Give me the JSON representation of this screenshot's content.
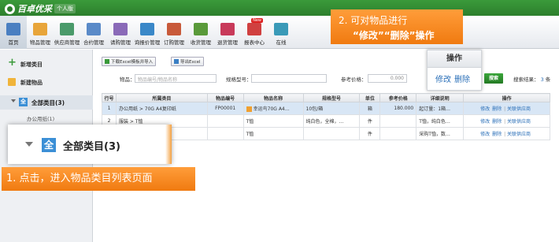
{
  "header": {
    "app_name": "百卓优采",
    "edition": "个人版"
  },
  "toolbar": {
    "items": [
      {
        "label": "首页",
        "icon": "home-icon",
        "color": "#4a7fc1"
      },
      {
        "label": "物品管理",
        "icon": "box-icon",
        "color": "#e8a53a"
      },
      {
        "label": "供应商管理",
        "icon": "supplier-icon",
        "color": "#4a9a6a"
      },
      {
        "label": "合约管理",
        "icon": "contract-icon",
        "color": "#5a8ac8"
      },
      {
        "label": "请购管理",
        "icon": "request-icon",
        "color": "#8a6ab8"
      },
      {
        "label": "询报价管理",
        "icon": "quote-icon",
        "color": "#3a88c8"
      },
      {
        "label": "订购管理",
        "icon": "order-icon",
        "color": "#c85a3a"
      },
      {
        "label": "收货管理",
        "icon": "receive-icon",
        "color": "#5a9a3a"
      },
      {
        "label": "退货管理",
        "icon": "return-icon",
        "color": "#c83a5a"
      },
      {
        "label": "报表中心",
        "icon": "report-icon",
        "color": "#d04040",
        "badge": "New"
      },
      {
        "label": "在线",
        "icon": "online-icon",
        "color": "#3a9ab8"
      }
    ]
  },
  "sidebar": {
    "add_category": "新增类目",
    "add_item": "新建物品",
    "tree_root": "全部类目(3)",
    "tree_child": "办公用纸(1)"
  },
  "content": {
    "import_btn": "下载Excel模板并导入",
    "export_btn": "导出Excel",
    "item_label": "物品：",
    "item_placeholder": "物品编号/物品名称",
    "spec_label": "规格型号：",
    "price_label": "参考价格：",
    "price_from": "0.000",
    "search_btn": "搜索",
    "result_label": "搜索结果：",
    "result_count": "3",
    "result_unit": "条"
  },
  "table": {
    "headers": [
      "行号",
      "所属类目",
      "物品编号",
      "物品名称",
      "规格型号",
      "单位",
      "参考价格",
      "详细说明",
      "操作"
    ],
    "rows": [
      {
        "no": "1",
        "category": "办公用纸 > 70G A4复印纸",
        "code": "FP00001",
        "name": "幸运鸟70G A4…",
        "spec": "10包/箱",
        "unit": "箱",
        "price": "180.000",
        "desc": "起订量：1箱…",
        "op_edit": "修改",
        "op_del": "删除",
        "op_link": "关联供应商"
      },
      {
        "no": "2",
        "category": "服装 > T恤",
        "code": "",
        "name": "T恤",
        "spec": "纯白色，全棉，…",
        "unit": "件",
        "price": "",
        "desc": "T恤，纯白色…",
        "op_edit": "修改",
        "op_del": "删除",
        "op_link": "关联供应商"
      },
      {
        "no": "",
        "category": "",
        "code": "",
        "name": "T恤",
        "spec": "",
        "unit": "件",
        "price": "",
        "desc": "采购T恤，数…",
        "op_edit": "修改",
        "op_del": "删除",
        "op_link": "关联供应商"
      }
    ]
  },
  "annotations": {
    "top_line1": "2. 可对物品进行",
    "top_line2": "“修改”“删除”操作",
    "op_header": "操作",
    "op_edit": "修改",
    "op_del": "删除",
    "tree_zoom": "全部类目(3)",
    "tree_zoom_q": "全",
    "bottom": "1. 点击，进入物品类目列表页面"
  }
}
